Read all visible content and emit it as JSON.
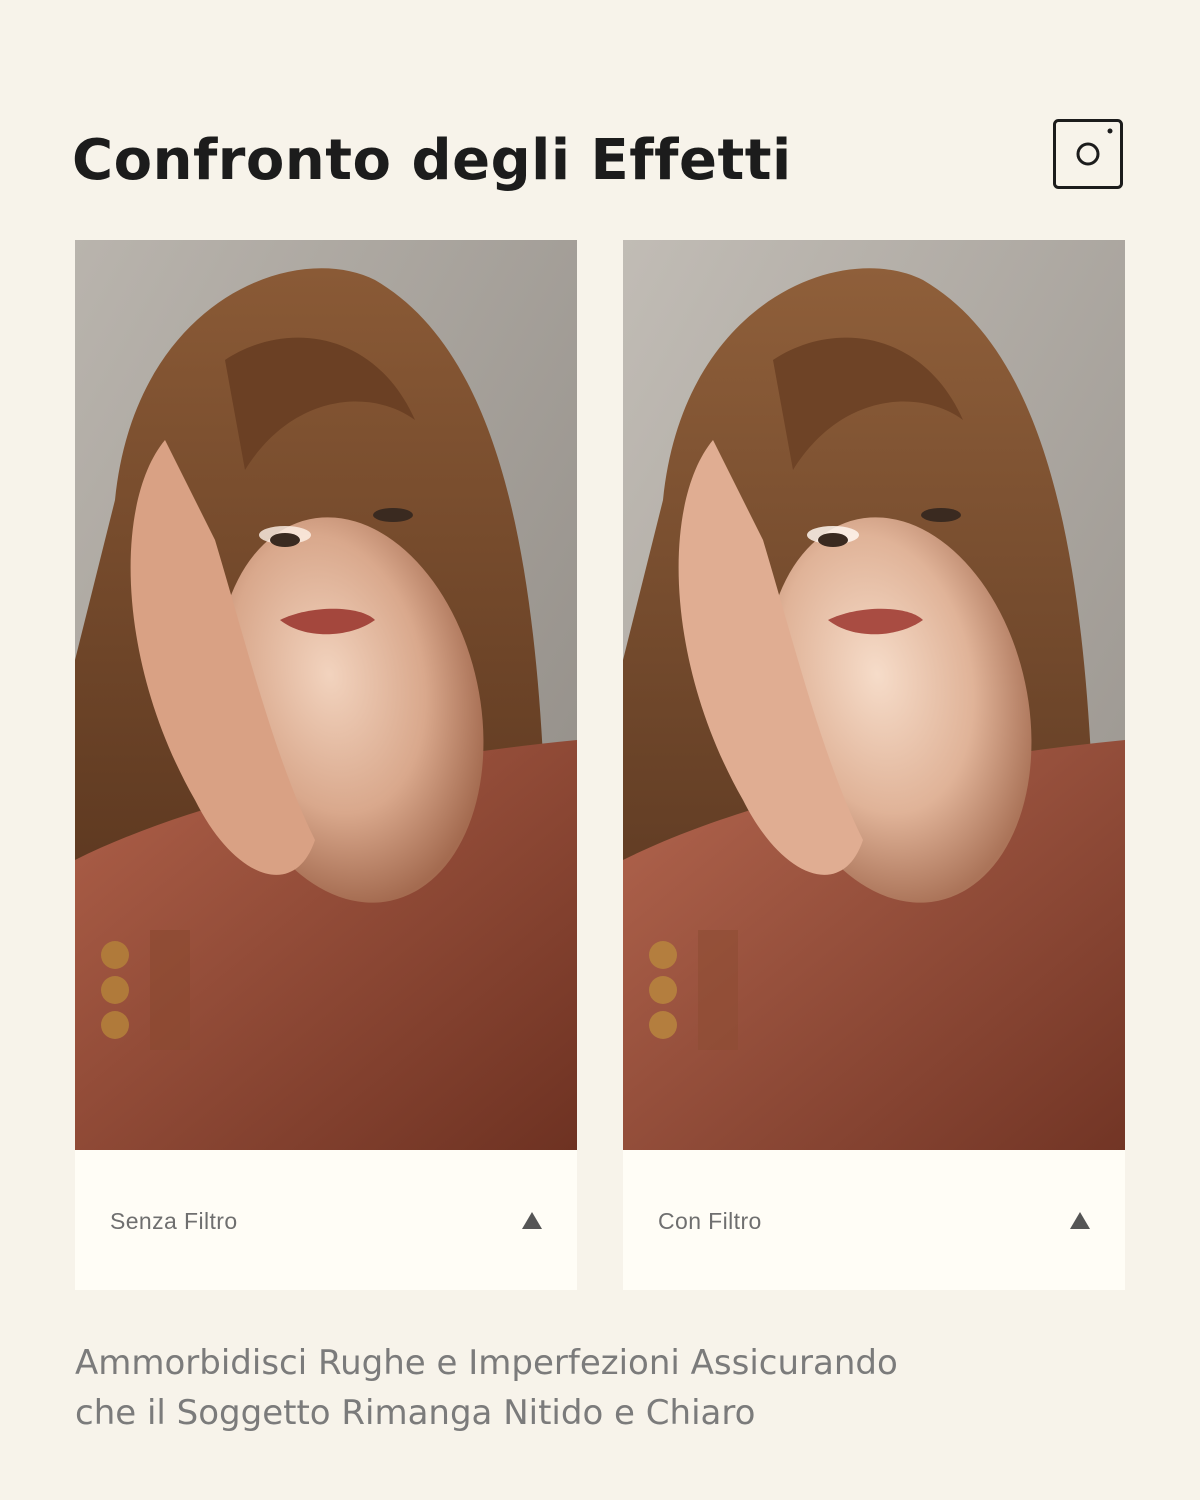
{
  "header": {
    "title": "Confronto degli Effetti",
    "icon": "camera-icon"
  },
  "panels": [
    {
      "label": "Senza Filtro",
      "icon": "triangle-up-icon",
      "filtered": false
    },
    {
      "label": "Con Filtro",
      "icon": "triangle-up-icon",
      "filtered": true
    }
  ],
  "footer": {
    "line1": "Ammorbidisci Rughe e Imperfezioni Assicurando",
    "line2": "che il Soggetto Rimanga Nitido e Chiaro"
  },
  "colors": {
    "background": "#f7f3ea",
    "caption_background": "#fffdf6",
    "title": "#1c1c1c",
    "text_gray": "#7b7b7b",
    "jacket": "#9a4f3a",
    "hair": "#6b4024"
  }
}
